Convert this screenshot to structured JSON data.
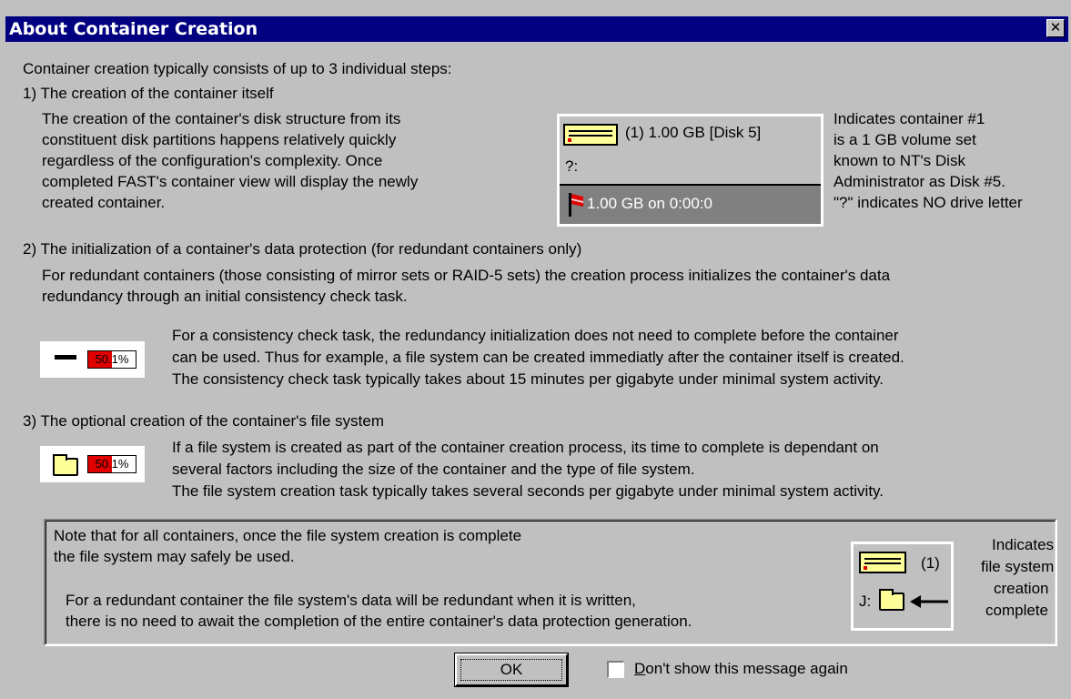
{
  "dialog": {
    "title": "About Container Creation",
    "close_glyph": "✕"
  },
  "intro": "Container creation typically consists of up to 3 individual steps:",
  "step1": {
    "heading": "1) The creation of the container itself",
    "lines": [
      "The creation of the container's disk structure from its",
      "constituent disk partitions happens relatively quickly",
      "regardless of the configuration's complexity. Once",
      "completed FAST's container view will display the newly",
      "created container."
    ],
    "sample": {
      "container_label": "(1)  1.00 GB  [Disk 5]",
      "drive_letter": "?:",
      "partition_label": "1.00 GB on 0:00:0"
    },
    "explanation": [
      "Indicates container #1",
      "is a 1 GB volume set",
      "known to NT's Disk",
      "Administrator as Disk #5.",
      "\"?\" indicates NO drive letter"
    ]
  },
  "step2": {
    "heading": "2) The initialization of a container's data protection (for redundant containers only)",
    "intro_lines": [
      "For redundant containers (those consisting of mirror sets or RAID-5 sets) the creation process initializes the container's data",
      "redundancy through an initial consistency check task."
    ],
    "progress": {
      "text": "50.1%",
      "fraction": 0.5
    },
    "lines": [
      "For a consistency check task, the redundancy initialization does not need to complete before the container",
      "can be used. Thus for example, a file system can be created immediatly after the container itself is created.",
      "The consistency check task typically takes about 15 minutes per gigabyte under minimal system activity."
    ]
  },
  "step3": {
    "heading": "3) The optional creation of the container's file system",
    "progress": {
      "text": "50.1%",
      "fraction": 0.5
    },
    "lines": [
      "If a file system is created as part of the container creation process, its time to complete is dependant on",
      "several factors including the size of the container and the type of file system.",
      "The file system creation task typically takes several seconds per gigabyte under minimal system activity."
    ]
  },
  "note": {
    "lines": [
      "Note that for all containers, once the file system creation is complete",
      "the file system may safely be used.",
      "For a redundant container the file system's data will be redundant when it is written,",
      "there is no need to await the completion of the entire container's data protection generation."
    ],
    "legend": {
      "container_label": "(1)",
      "drive_letter": "J:",
      "caption": [
        "Indicates",
        "file system",
        "creation",
        "complete"
      ]
    }
  },
  "footer": {
    "ok_label": "OK",
    "checkbox_label": "Don't show this message again",
    "checkbox_checked": false
  },
  "colors": {
    "title_bar": "#000080",
    "dialog_bg": "#c0c0c0",
    "progress_fill": "#e00000",
    "icon_yellow": "#ffff99"
  }
}
